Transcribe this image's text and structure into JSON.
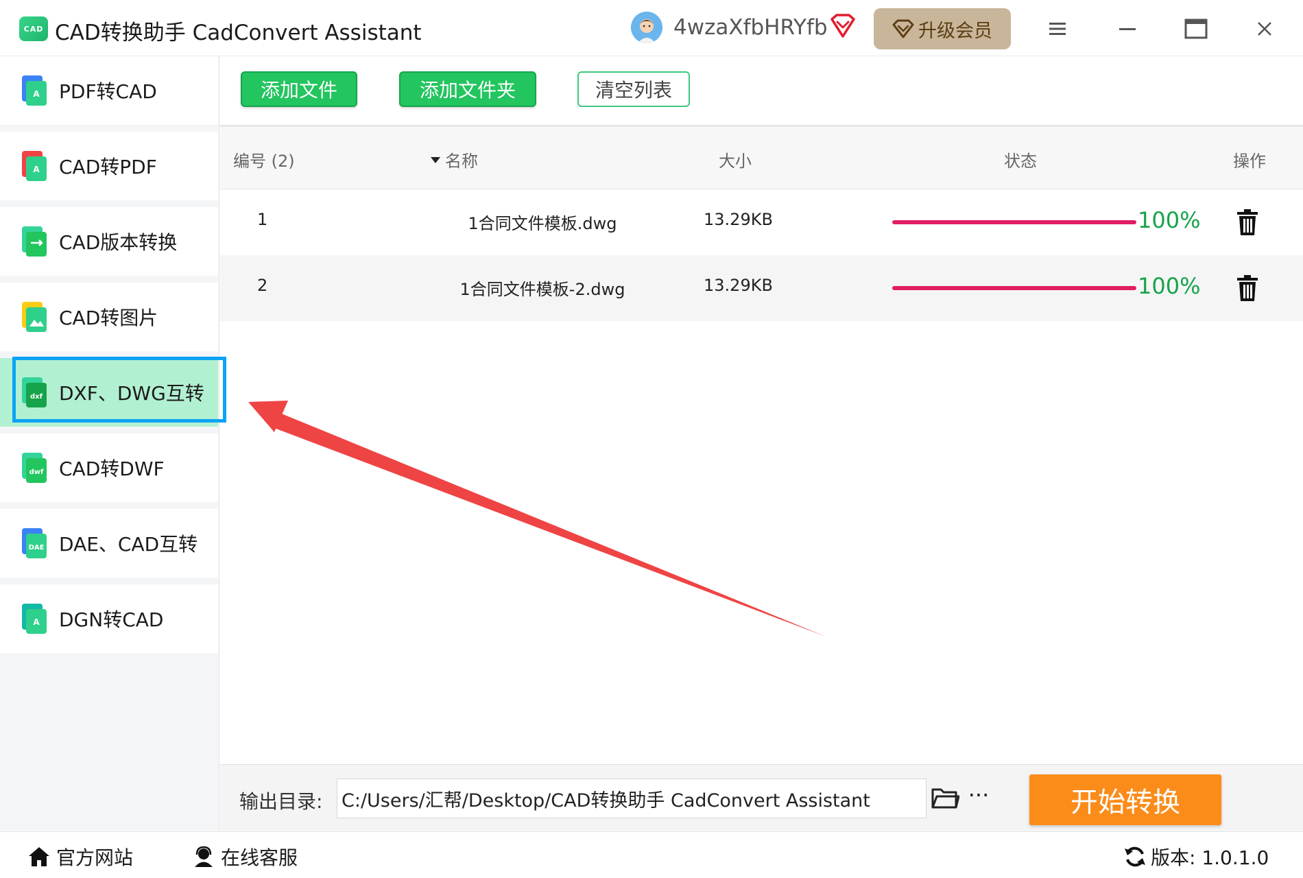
{
  "window": {
    "logo_text": "CAD",
    "title": "CAD转换助手 CadConvert Assistant",
    "username": "4wzaXfbHRYfb",
    "upgrade_label": "升级会员",
    "controls": [
      "menu-icon",
      "minimize-icon",
      "maximize-icon",
      "close-icon"
    ]
  },
  "sidebar": {
    "items": [
      {
        "label": "PDF转CAD",
        "icon": "pdf-to-cad-icon"
      },
      {
        "label": "CAD转PDF",
        "icon": "cad-to-pdf-icon"
      },
      {
        "label": "CAD版本转换",
        "icon": "cad-version-icon"
      },
      {
        "label": "CAD转图片",
        "icon": "cad-to-image-icon"
      },
      {
        "label": "DXF、DWG互转",
        "icon": "dxf-dwg-icon",
        "active": true
      },
      {
        "label": "CAD转DWF",
        "icon": "cad-to-dwf-icon"
      },
      {
        "label": "DAE、CAD互转",
        "icon": "dae-cad-icon"
      },
      {
        "label": "DGN转CAD",
        "icon": "dgn-to-cad-icon"
      }
    ]
  },
  "toolbar": {
    "add_file": "添加文件",
    "add_folder": "添加文件夹",
    "clear_list": "清空列表"
  },
  "table": {
    "columns": {
      "index": "编号 (2)",
      "name": "名称",
      "size": "大小",
      "status": "状态",
      "action": "操作"
    },
    "rows": [
      {
        "index": "1",
        "name": "1合同文件模板.dwg",
        "size": "13.29KB",
        "progress": 100,
        "percent": "100%"
      },
      {
        "index": "2",
        "name": "1合同文件模板-2.dwg",
        "size": "13.29KB",
        "progress": 100,
        "percent": "100%"
      }
    ]
  },
  "output": {
    "label": "输出目录:",
    "path": "C:/Users/汇帮/Desktop/CAD转换助手 CadConvert Assistant",
    "start_label": "开始转换"
  },
  "footer": {
    "website": "官方网站",
    "support": "在线客服",
    "version": "版本:  1.0.1.0"
  },
  "colors": {
    "primary_green": "#22c55e",
    "active_item_bg": "#b2f0d2",
    "active_frame": "#0aa3f5",
    "progress": "#e11d63",
    "percent_text": "#16a34a",
    "start_button": "#fb8c1a",
    "upgrade_button": "#c8b59a",
    "annotation_arrow": "#ef4444"
  }
}
